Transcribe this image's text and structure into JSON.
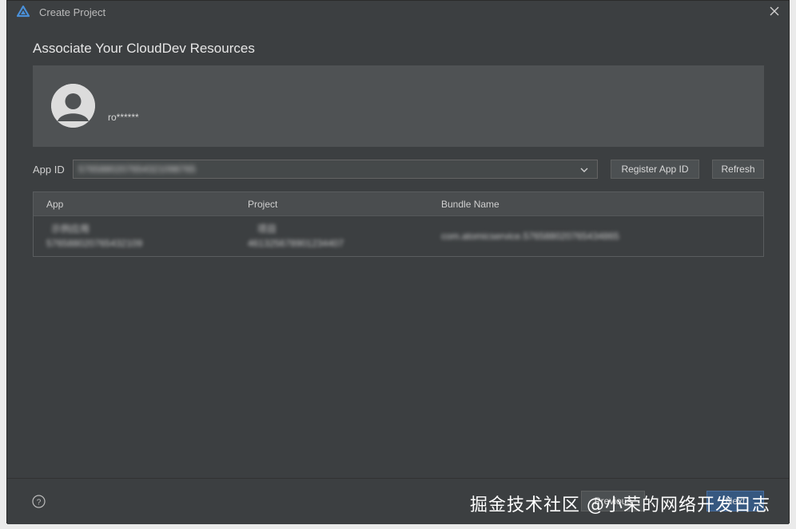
{
  "window": {
    "title": "Create Project",
    "logo_icon": "harmony-logo-icon",
    "close_icon": "close-icon"
  },
  "heading": "Associate Your CloudDev Resources",
  "account": {
    "username": "ro******",
    "avatar_icon": "user-avatar-icon"
  },
  "app_id": {
    "label": "App ID",
    "selected_value": "5765880207654321098765",
    "register_label": "Register App ID",
    "refresh_label": "Refresh"
  },
  "table": {
    "columns": [
      "App",
      "Project",
      "Bundle Name"
    ],
    "rows": [
      {
        "app_name": "示例应用",
        "app_id": "576588020765432109",
        "project_name": "项目",
        "project_id": "461325678901234407",
        "bundle_name": "com.atomicservice.576588020765434865"
      }
    ]
  },
  "footer": {
    "help_icon": "help-circle-icon",
    "previous_label": "Previous",
    "next_label": "Next"
  },
  "watermark": "掘金技术社区 @小荣的网络开发日志",
  "colors": {
    "background": "#3c3f41",
    "panel": "#4f5254",
    "primary_button": "#365880"
  }
}
